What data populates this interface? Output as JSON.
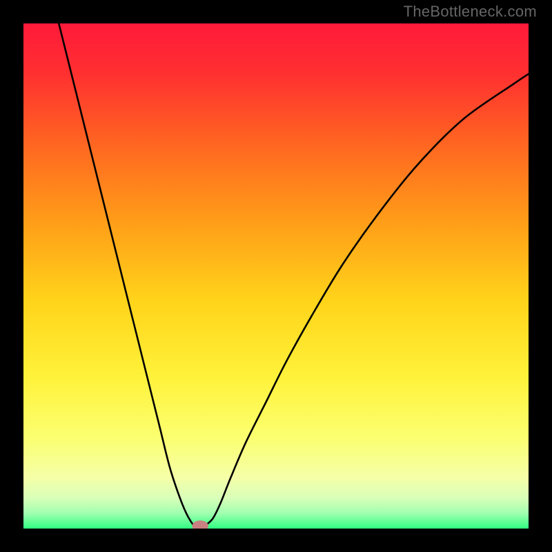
{
  "watermark": "TheBottleneck.com",
  "colors": {
    "bg": "#000000",
    "curve": "#000000",
    "marker_fill": "#c98080",
    "marker_stroke": "#aa6666",
    "gradient_stops": [
      {
        "offset": 0.0,
        "color": "#ff1a3a"
      },
      {
        "offset": 0.1,
        "color": "#ff3030"
      },
      {
        "offset": 0.25,
        "color": "#ff6a20"
      },
      {
        "offset": 0.4,
        "color": "#ffa018"
      },
      {
        "offset": 0.55,
        "color": "#ffd41a"
      },
      {
        "offset": 0.7,
        "color": "#fff23a"
      },
      {
        "offset": 0.82,
        "color": "#fbff70"
      },
      {
        "offset": 0.9,
        "color": "#f5ffa8"
      },
      {
        "offset": 0.94,
        "color": "#d8ffb8"
      },
      {
        "offset": 0.97,
        "color": "#a0ffb0"
      },
      {
        "offset": 1.0,
        "color": "#30ff80"
      }
    ]
  },
  "chart_data": {
    "type": "line",
    "title": "",
    "xlabel": "",
    "ylabel": "",
    "xlim": [
      0,
      100
    ],
    "ylim": [
      0,
      100
    ],
    "x": [
      7,
      9,
      11,
      13,
      15,
      17,
      19,
      21,
      23,
      25,
      27,
      29,
      31,
      32.5,
      34,
      35,
      35.5,
      36,
      37.5,
      39,
      41,
      44,
      48,
      52,
      57,
      63,
      70,
      78,
      87,
      97,
      100
    ],
    "values": [
      100,
      92,
      84,
      76,
      68,
      60,
      52,
      44,
      36,
      28,
      20,
      12,
      6,
      2.5,
      0.3,
      0,
      0.2,
      0.6,
      2,
      5,
      10,
      17,
      25,
      33,
      42,
      52,
      62,
      72,
      81,
      88,
      90
    ],
    "marker": {
      "x": 35,
      "y": 0.5,
      "rx": 1.6,
      "ry": 1.1
    },
    "grid": false,
    "legend": false
  }
}
